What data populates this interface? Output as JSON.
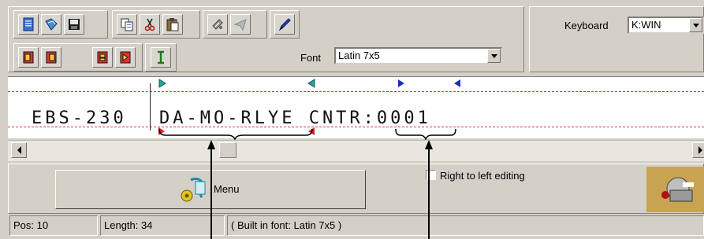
{
  "toolbar": {
    "row1": [
      {
        "name": "new-document-icon"
      },
      {
        "name": "open-icon"
      },
      {
        "name": "save-icon"
      },
      {
        "name": "copy-icon"
      },
      {
        "name": "cut-icon"
      },
      {
        "name": "paste-icon"
      },
      {
        "name": "print-icon"
      },
      {
        "name": "send-icon"
      },
      {
        "name": "pen-icon"
      }
    ],
    "row2": [
      {
        "name": "align-left-icon"
      },
      {
        "name": "align-right-icon"
      },
      {
        "name": "marker-start-icon"
      },
      {
        "name": "marker-end-icon"
      },
      {
        "name": "text-cursor-icon"
      }
    ]
  },
  "keyboard": {
    "label": "Keyboard",
    "value": "K:WIN"
  },
  "font": {
    "label": "Font",
    "value": "Latin 7x5"
  },
  "editor": {
    "prefix": "EBS-230",
    "body": "DA-MO-RLYE CNTR:0001"
  },
  "menu_button": {
    "label": "Menu"
  },
  "rtl_checkbox": {
    "label": "Right to left editing",
    "checked": false
  },
  "status": {
    "pos": "Pos: 10",
    "length": "Length: 34",
    "font_info": "( Built in font: Latin 7x5 )"
  },
  "colors": {
    "marker_green": "#2aa39a",
    "marker_blue": "#1c2fb6",
    "marker_red": "#d42020",
    "guide_red": "#d23a3a"
  }
}
